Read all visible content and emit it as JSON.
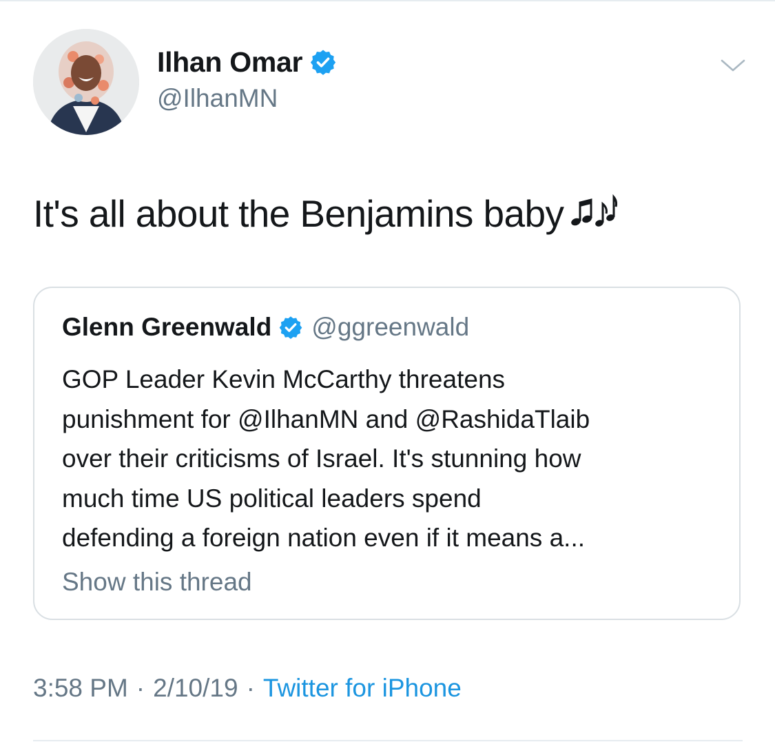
{
  "author": {
    "name": "Ilhan Omar",
    "handle": "@IlhanMN",
    "verified": true,
    "avatar_icon": "profile-photo"
  },
  "tweet": {
    "text": "It's all about the Benjamins baby",
    "emoji_icon": "musical-notes-icon"
  },
  "quoted_tweet": {
    "author_name": "Glenn Greenwald",
    "handle": "@ggreenwald",
    "verified": true,
    "lines": [
      "GOP Leader Kevin McCarthy threatens",
      "punishment for @IlhanMN and @RashidaTlaib",
      "over their criticisms of Israel. It's stunning how",
      "much time US political leaders spend",
      "defending a foreign nation even if it means a..."
    ],
    "show_thread_label": "Show this thread"
  },
  "meta": {
    "time": "3:58 PM",
    "date": "2/10/19",
    "separator": "·",
    "source": "Twitter for iPhone"
  },
  "colors": {
    "verified_blue": "#1da1f2",
    "secondary_text": "#657786",
    "link_blue": "#1b95e0"
  }
}
